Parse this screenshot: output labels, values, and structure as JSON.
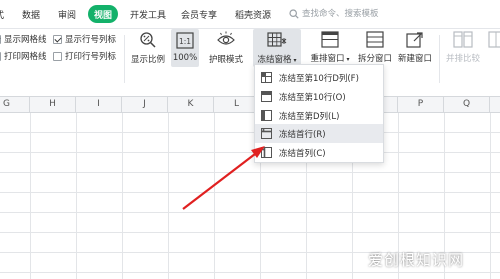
{
  "menu": {
    "tabs": [
      "公式",
      "数据",
      "审阅",
      "视图",
      "开发工具",
      "会员专享",
      "稻壳资源"
    ],
    "active_tab": "视图",
    "search_placeholder": "查找命令、搜索模板"
  },
  "view_options": {
    "gridlines": {
      "label": "显示网格线",
      "checked": true
    },
    "row_col_headers": {
      "label": "显示行号列标",
      "checked": true
    },
    "print_gridlines": {
      "label": "打印网格线",
      "checked": false
    },
    "print_row_col_headers": {
      "label": "打印行号列标",
      "checked": false
    }
  },
  "toolbar": {
    "zoom_label": "显示比例",
    "zoom_100_label": "100%",
    "eye_protection_label": "护眼模式",
    "freeze_panes_label": "冻结窗格",
    "arrange_windows_label": "重排窗口",
    "split_window_label": "拆分窗口",
    "new_window_label": "新建窗口",
    "side_by_side_label": "并排比较",
    "icon_100_text": "1:1"
  },
  "column_headers": [
    "G",
    "H",
    "I",
    "J",
    "K",
    "L",
    "M",
    "N",
    "O",
    "P",
    "Q",
    "R"
  ],
  "freeze_menu": {
    "items": [
      {
        "label": "冻结至第10行D列(F)",
        "icon": "freeze-row-col-icon",
        "highlighted": false
      },
      {
        "label": "冻结至第10行(O)",
        "icon": "freeze-rows-icon",
        "highlighted": false
      },
      {
        "label": "冻结至第D列(L)",
        "icon": "freeze-cols-icon",
        "highlighted": false
      },
      {
        "label": "冻结首行(R)",
        "icon": "freeze-top-row-icon",
        "highlighted": true
      },
      {
        "label": "冻结首列(C)",
        "icon": "freeze-first-col-icon",
        "highlighted": false
      }
    ]
  },
  "colors": {
    "accent": "#13b16a",
    "arrow": "#e02020"
  },
  "watermark": "爱创根知识网"
}
